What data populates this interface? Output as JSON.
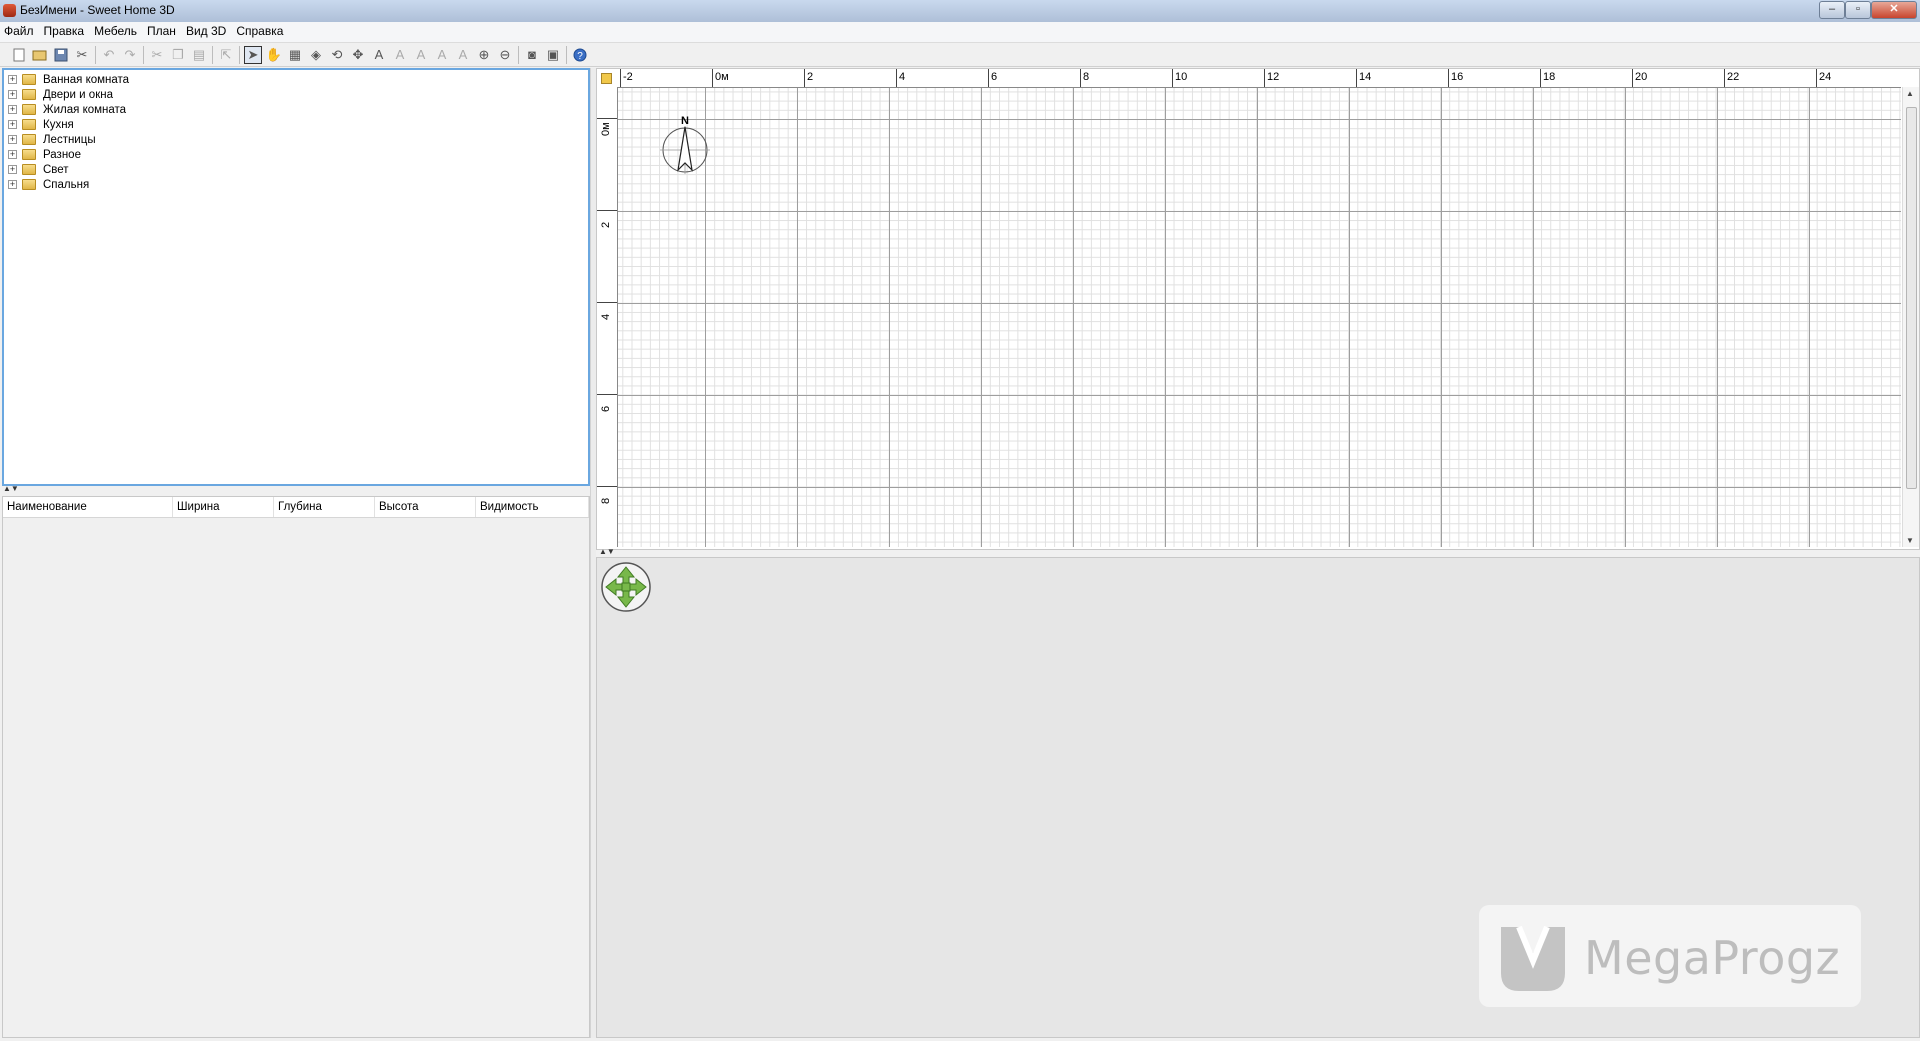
{
  "window": {
    "title": "БезИмени - Sweet Home 3D"
  },
  "menu": [
    "Файл",
    "Правка",
    "Мебель",
    "План",
    "Вид 3D",
    "Справка"
  ],
  "toolbar": {
    "buttons": [
      "new-icon",
      "open-icon",
      "save-icon",
      "cut-icon",
      "undo-icon",
      "redo-icon",
      "cut-icon",
      "copy-icon",
      "paste-icon",
      "add-furniture-icon",
      "select-icon",
      "pan-icon",
      "create-walls-icon",
      "create-rooms-icon",
      "create-polylines-icon",
      "create-dimensions-icon",
      "add-text-icon",
      "increase-text-icon",
      "decrease-text-icon",
      "bold-icon",
      "italic-icon",
      "zoom-in-icon",
      "zoom-out-icon",
      "photo-icon",
      "video-icon",
      "help-icon"
    ]
  },
  "catalog": {
    "categories": [
      "Ванная комната",
      "Двери и окна",
      "Жилая комната",
      "Кухня",
      "Лестницы",
      "Разное",
      "Свет",
      "Спальня"
    ]
  },
  "furniture_table": {
    "columns": [
      "Наименование",
      "Ширина",
      "Глубина",
      "Высота",
      "Видимость"
    ]
  },
  "plan": {
    "x_ruler_labels": [
      "-2",
      "0м",
      "2",
      "4",
      "6",
      "8",
      "10",
      "12",
      "14",
      "16",
      "18",
      "20",
      "22",
      "24"
    ],
    "y_ruler_labels": [
      "0м",
      "2",
      "4",
      "6",
      "8"
    ],
    "compass_label": "N"
  },
  "watermark": {
    "text": "MegaProgz"
  }
}
